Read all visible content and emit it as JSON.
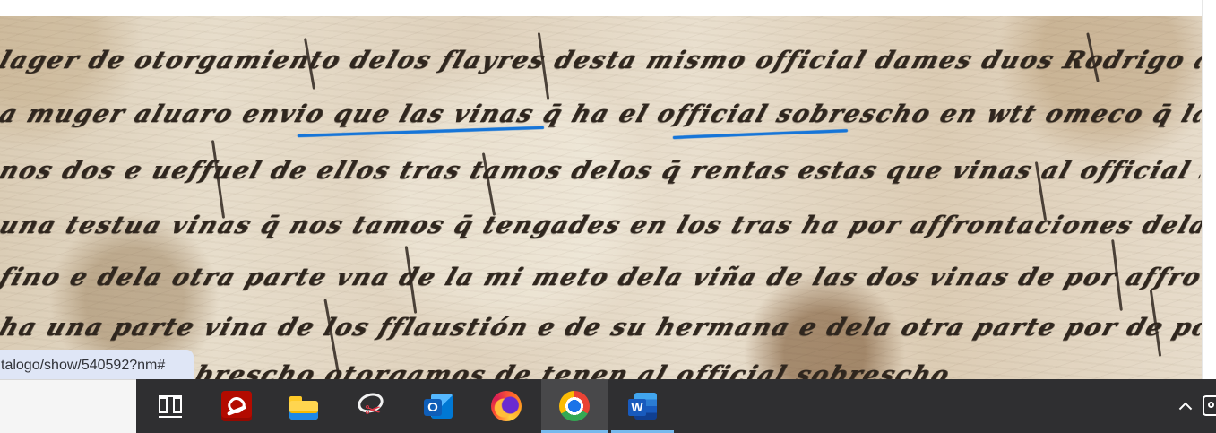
{
  "browser": {
    "status_url": "talogo/show/540592?nm#"
  },
  "manuscript": {
    "lines": [
      "lager de otorgamiento delos flayres desta mismo official dames duos Rodrigo aluares de wtt omeco fue aluar",
      "a muger aluaro envio que las vinas q̄ ha el official sobrescho en wtt omeco q̄ las tengades en vida uos",
      "nos dos e ueffuel de ellos tras tamos delos q̄ rentas estas que vinas al official sobrescho",
      "una testua vinas q̄ nos tamos q̄ tengades en los tras ha por affrontaciones dela vna parte la",
      "fino e dela otra parte vna de la mi meto dela viña de las dos vinas de por affrontac",
      "ha una parte vina de los fflaustión e de su hermana e dela otra parte por de poblacio de yo",
      "muger los sobrescho otorgamos de tenen al official sobrescho"
    ]
  },
  "annotations": {
    "underline_color": "#1675d8"
  },
  "taskbar": {
    "background_color": "#2f2f31",
    "active_app": "chrome",
    "apps": [
      {
        "name": "Task View",
        "icon": "task-view-icon"
      },
      {
        "name": "Adobe Acrobat",
        "icon": "pdf-icon"
      },
      {
        "name": "File Explorer",
        "icon": "folder-icon"
      },
      {
        "name": "Snip & Sketch",
        "icon": "snip-icon"
      },
      {
        "name": "Outlook",
        "icon": "outlook-icon"
      },
      {
        "name": "Firefox",
        "icon": "firefox-icon"
      },
      {
        "name": "Chrome",
        "icon": "chrome-icon"
      },
      {
        "name": "Word",
        "icon": "word-icon"
      }
    ],
    "tray": {
      "chevron_icon": "chevron-up-icon",
      "edge_icon": "tray-icon"
    }
  },
  "icons": {
    "outlook_letter": "O",
    "word_letter": "W"
  }
}
